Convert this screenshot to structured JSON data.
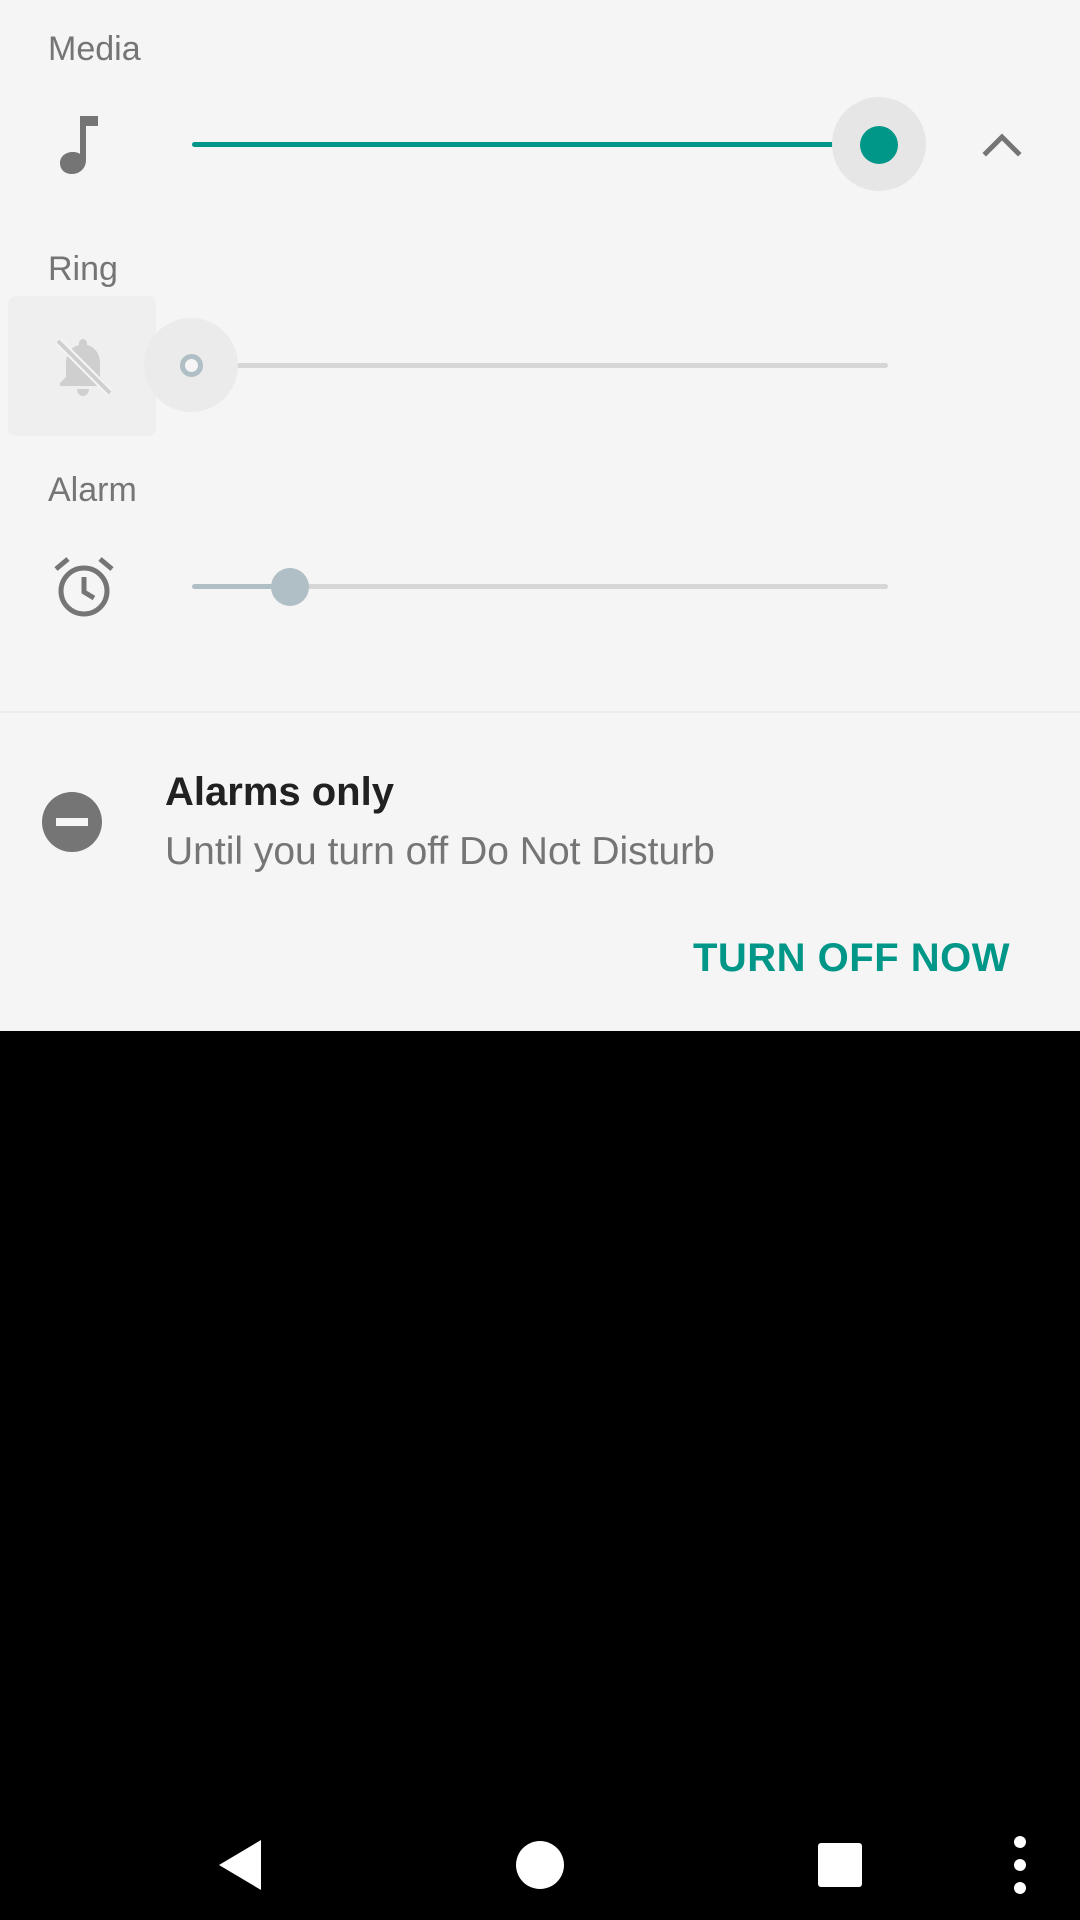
{
  "volume": {
    "rows": [
      {
        "id": "media",
        "label": "Media",
        "icon": "music-note-icon",
        "level": 1.0
      },
      {
        "id": "ring",
        "label": "Ring",
        "icon": "bell-off-icon",
        "level": 0.0
      },
      {
        "id": "alarm",
        "label": "Alarm",
        "icon": "alarm-clock-icon",
        "level": 0.14
      }
    ],
    "expand_icon": "chevron-up-icon"
  },
  "dnd": {
    "title": "Alarms only",
    "subtitle": "Until you turn off Do Not Disturb",
    "action_label": "TURN OFF NOW",
    "icon": "do-not-disturb-icon"
  },
  "nav": {
    "buttons": [
      "back-icon",
      "home-icon",
      "recents-icon",
      "overflow-menu-icon"
    ]
  },
  "colors": {
    "accent": "#009688",
    "panel_bg": "#f5f5f5",
    "muted": "#b0bec5",
    "track": "#d6d6d6",
    "icon": "#757575"
  }
}
